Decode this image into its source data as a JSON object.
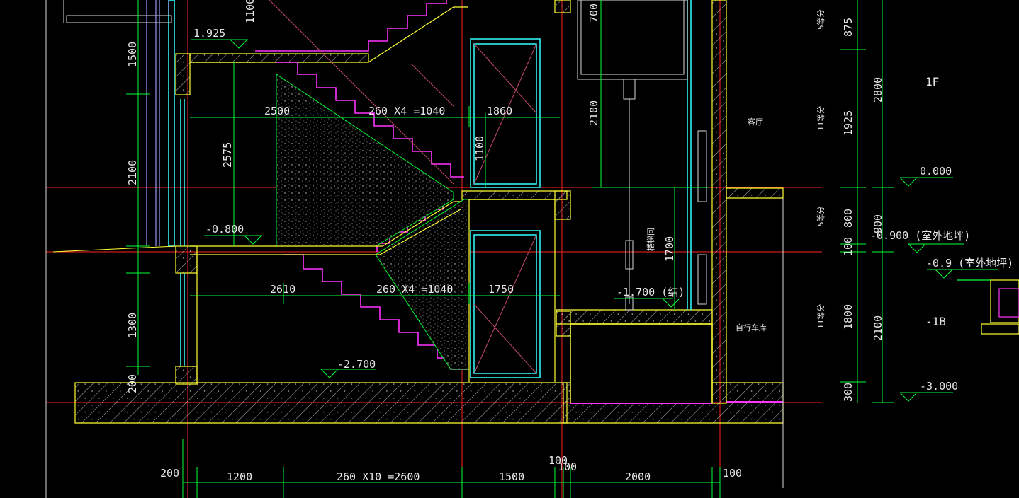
{
  "drawing": {
    "colors": {
      "background": "#000000",
      "wall": "#ffff33",
      "dimension": "#00ff33",
      "axis": "#ff2222",
      "stair": "#ff33ff",
      "window": "#33ffff",
      "text": "#e8e8e8",
      "partition": "#9a9aff"
    },
    "dimensions": {
      "h_bottom": [
        "200",
        "1200",
        "260 X10 =2600",
        "1500",
        "100",
        "100",
        "2000",
        "100"
      ],
      "h_upper": [
        "2500",
        "260 X4 =1040",
        "1860"
      ],
      "h_lower": [
        "2610",
        "260 X4 =1040",
        "1750"
      ],
      "v_left": [
        "1500",
        "2100",
        "1300",
        "200"
      ],
      "v_inner": [
        "1100",
        "2575"
      ],
      "v_door": [
        "1100"
      ],
      "v_mid": [
        "700",
        "2100",
        "1700"
      ],
      "v_right1": [
        "875",
        "1925",
        "800",
        "100",
        "1800",
        "300"
      ],
      "v_right2": [
        "2800",
        "900",
        "2100"
      ]
    },
    "levels": [
      "1.925",
      "-0.800",
      "-2.700",
      "-1.700 (结)",
      "0.000",
      "-0.900 (室外地坪)",
      "-0.9 (室外地坪)",
      "-3.000"
    ],
    "room_labels": [
      "客厅",
      "自行车库",
      "楼梯间"
    ],
    "division_notes": [
      "5等分",
      "11等分",
      "5等分",
      "11等分"
    ],
    "floor_labels": [
      "1F",
      "-1B"
    ]
  }
}
